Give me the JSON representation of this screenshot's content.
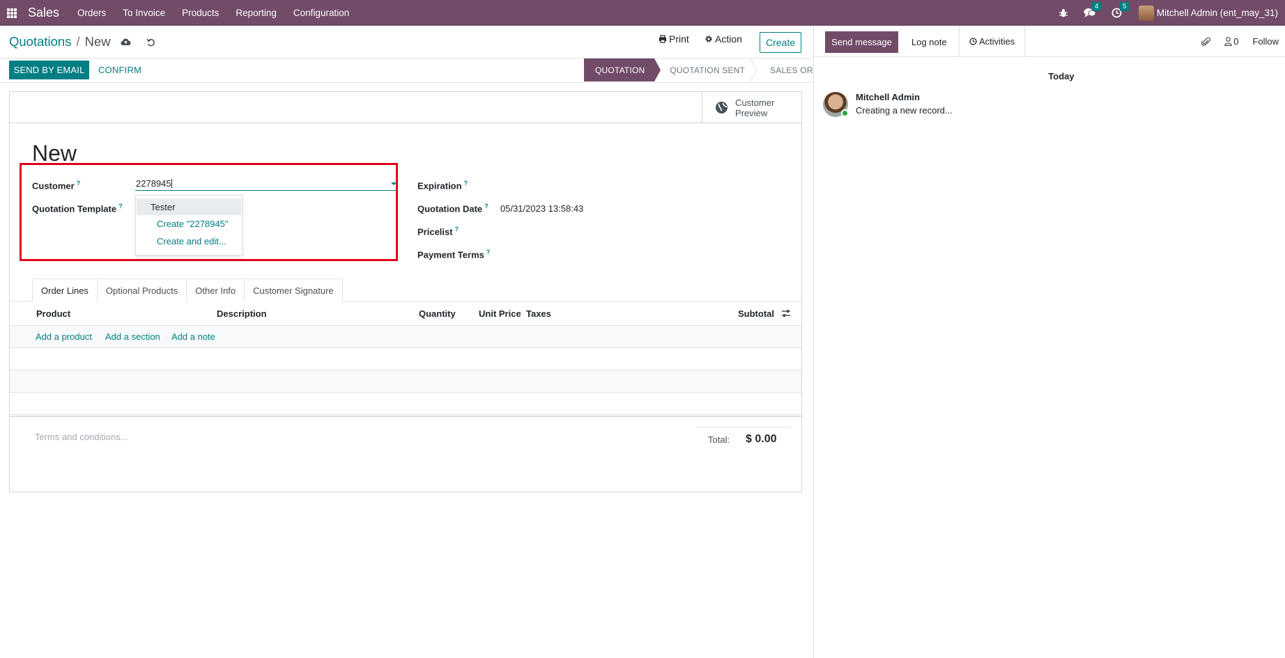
{
  "navbar": {
    "app_name": "Sales",
    "menu": [
      "Orders",
      "To Invoice",
      "Products",
      "Reporting",
      "Configuration"
    ],
    "messages_count": "4",
    "activities_count": "5",
    "user": "Mitchell Admin (ent_may_31)",
    "color": "#714B67"
  },
  "control_panel": {
    "breadcrumb_parent": "Quotations",
    "breadcrumb_separator": "/",
    "breadcrumb_current": "New",
    "print_label": "Print",
    "action_label": "Action",
    "create_label": "Create"
  },
  "statusbar": {
    "send_by_email_label": "SEND BY EMAIL",
    "confirm_label": "CONFIRM",
    "stages": [
      {
        "label": "QUOTATION",
        "active": true
      },
      {
        "label": "QUOTATION SENT",
        "active": false
      },
      {
        "label": "SALES ORDER",
        "active": false
      }
    ]
  },
  "form": {
    "customer_preview_label": "Customer Preview",
    "title": "New",
    "customer_label": "Customer",
    "customer_value": "2278945",
    "quotation_template_label": "Quotation Template",
    "expiration_label": "Expiration",
    "quotation_date_label": "Quotation Date",
    "quotation_date_value": "05/31/2023 13:58:43",
    "pricelist_label": "Pricelist",
    "payment_terms_label": "Payment Terms",
    "help_mark": "?",
    "autocomplete": {
      "suggestion": "Tester",
      "create_label": "Create \"2278945\"",
      "create_edit_label": "Create and edit..."
    },
    "tabs": [
      "Order Lines",
      "Optional Products",
      "Other Info",
      "Customer Signature"
    ],
    "columns": {
      "product": "Product",
      "description": "Description",
      "quantity": "Quantity",
      "unit_price": "Unit Price",
      "taxes": "Taxes",
      "subtotal": "Subtotal"
    },
    "add_product": "Add a product",
    "add_section": "Add a section",
    "add_note": "Add a note",
    "terms_placeholder": "Terms and conditions...",
    "total_label": "Total:",
    "total_value": "$ 0.00"
  },
  "chatter": {
    "send_message_label": "Send message",
    "log_note_label": "Log note",
    "activities_label": "Activities",
    "followers_count": "0",
    "follow_label": "Follow",
    "date_separator": "Today",
    "author": "Mitchell Admin",
    "message": "Creating a new record..."
  },
  "accent_color": "#017e84",
  "highlight_color": "#e0001b"
}
